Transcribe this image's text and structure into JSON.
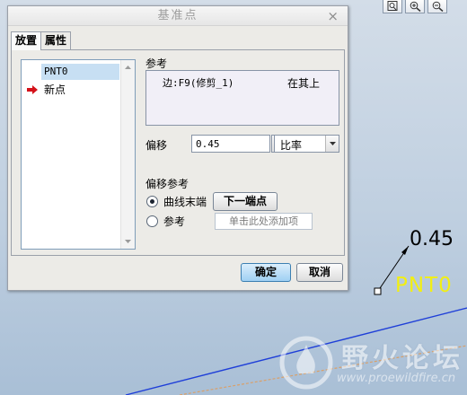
{
  "dialog": {
    "title": "基准点",
    "close": "×",
    "tabs": [
      {
        "label": "放置",
        "active": true
      },
      {
        "label": "属性",
        "active": false
      }
    ],
    "tree": {
      "items": [
        {
          "label": "PNT0",
          "selected": true
        },
        {
          "label": "新点",
          "selected": false,
          "icon": "red-arrow-icon"
        }
      ]
    },
    "reference": {
      "label": "参考",
      "rows": [
        {
          "edge": "边:F9(修剪_1)",
          "type": "在其上"
        }
      ]
    },
    "offset": {
      "label": "偏移",
      "value": "0.45",
      "mode": "比率"
    },
    "offset_reference": {
      "label": "偏移参考",
      "options": [
        {
          "label": "曲线末端",
          "checked": true,
          "button": "下一端点"
        },
        {
          "label": "参考",
          "checked": false,
          "placeholder": "单击此处添加项"
        }
      ]
    },
    "buttons": {
      "ok": "确定",
      "cancel": "取消"
    }
  },
  "graphics": {
    "offset_value": "0.45",
    "point_name": "PNT0",
    "point_label_color": "#f2ef12",
    "curve_color": "#1f3fd8",
    "toolbar_icons": [
      "refit-zoom-icon",
      "zoom-in-icon",
      "zoom-out-icon"
    ]
  },
  "watermark": {
    "title": "野火论坛",
    "url": "www.proewildfire.cn"
  }
}
